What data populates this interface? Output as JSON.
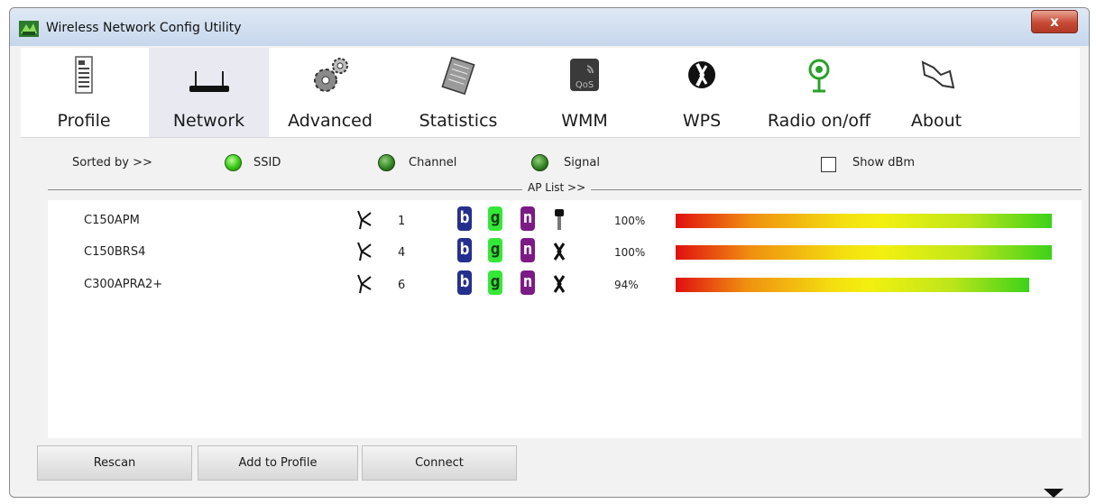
{
  "window": {
    "title": "Wireless Network Config Utility",
    "close_label": "x"
  },
  "toolbar": {
    "items": [
      {
        "label": "Profile",
        "icon": "profile-icon",
        "active": false
      },
      {
        "label": "Network",
        "icon": "network-router-icon",
        "active": true
      },
      {
        "label": "Advanced",
        "icon": "gears-icon",
        "active": false
      },
      {
        "label": "Statistics",
        "icon": "statistics-chip-icon",
        "active": false
      },
      {
        "label": "WMM",
        "icon": "qos-icon",
        "active": false
      },
      {
        "label": "WPS",
        "icon": "wps-icon",
        "active": false
      },
      {
        "label": "Radio on/off",
        "icon": "radio-icon",
        "active": false
      },
      {
        "label": "About",
        "icon": "about-icon",
        "active": false
      }
    ]
  },
  "sort": {
    "label": "Sorted by >>",
    "options": [
      {
        "label": "SSID",
        "selected": true
      },
      {
        "label": "Channel",
        "selected": false
      },
      {
        "label": "Signal",
        "selected": false
      }
    ],
    "show_dbm_label": "Show dBm",
    "show_dbm_checked": false
  },
  "ap_list": {
    "title": "AP List >>",
    "rows": [
      {
        "ssid": "C150APM",
        "channel": "1",
        "modes": [
          "b",
          "g",
          "n"
        ],
        "security_icon": "key-icon",
        "signal_text": "100%",
        "signal": 1.0
      },
      {
        "ssid": "C150BRS4",
        "channel": "4",
        "modes": [
          "b",
          "g",
          "n"
        ],
        "security_icon": "wps-icon",
        "signal_text": "100%",
        "signal": 1.0
      },
      {
        "ssid": "C300APRA2+",
        "channel": "6",
        "modes": [
          "b",
          "g",
          "n"
        ],
        "security_icon": "wps-icon",
        "signal_text": "94%",
        "signal": 0.94
      }
    ]
  },
  "buttons": {
    "rescan": "Rescan",
    "add_to_profile": "Add to Profile",
    "connect": "Connect"
  },
  "colors": {
    "mode_b": "#24308e",
    "mode_g": "#35e838",
    "mode_n": "#7c1a86",
    "radio_on": "#36c414",
    "close_button": "#c74a36"
  }
}
